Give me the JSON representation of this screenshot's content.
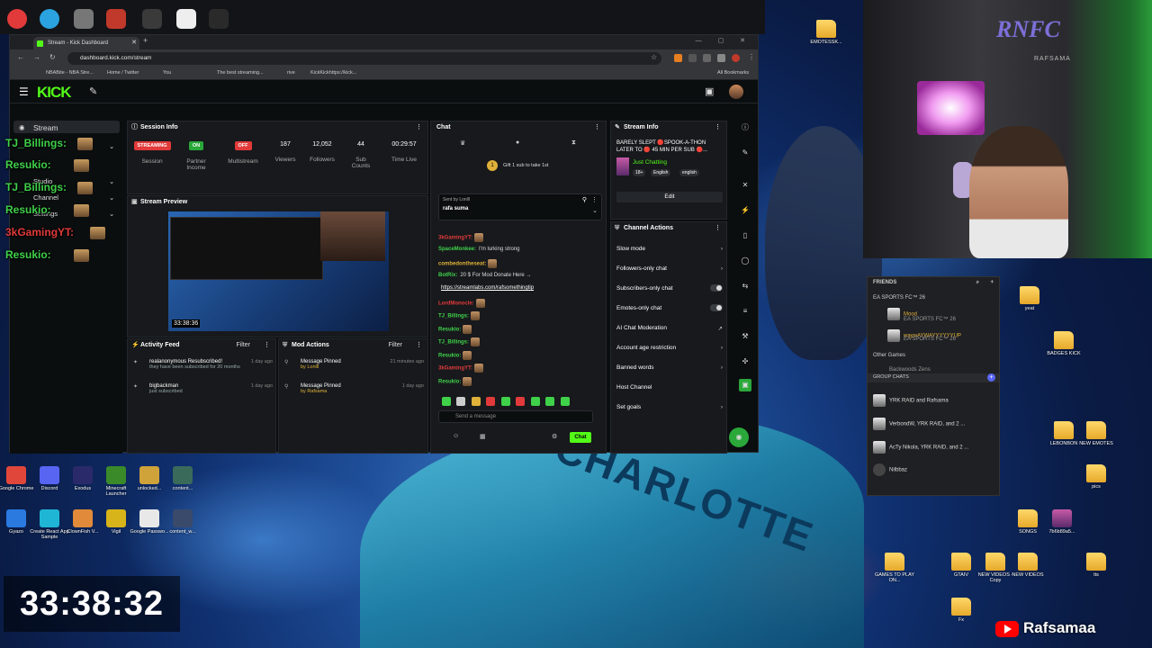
{
  "browser": {
    "tab_title": "Stream - Kick Dashboard",
    "new_tab": "+",
    "window_controls": "— ▢ ✕",
    "url": "dashboard.kick.com/stream",
    "bookmarks": [
      "NBABite - NBA Stre...",
      "Home / Twitter",
      "You",
      "The best streaming...",
      "rive",
      "KickKickhttps://kick..."
    ],
    "all_bookmarks": "All Bookmarks"
  },
  "kick": {
    "logo": "KICK",
    "sidebar": {
      "stream": "Stream",
      "studio": "Studio",
      "channel": "Channel",
      "settings": "Settings"
    },
    "overlay_names": [
      {
        "text": "TJ_Billings:",
        "color": "#3fd14a"
      },
      {
        "text": "Resukio:",
        "color": "#3fd14a"
      },
      {
        "text": "TJ_Billings:",
        "color": "#3fd14a"
      },
      {
        "text": "Resukio:",
        "color": "#3fd14a"
      },
      {
        "text": "3kGamingYT:",
        "color": "#e23a3a"
      },
      {
        "text": "Resukio:",
        "color": "#3fd14a"
      }
    ],
    "session_info": {
      "title": "Session Info",
      "streaming_pill": "STREAMING",
      "session_label": "Session",
      "partner_pill": "ON",
      "partner_label": "Partner Income",
      "multistream_pill": "OFF",
      "multistream_label": "Multistream",
      "viewers": "187",
      "viewers_label": "Viewers",
      "followers": "12,052",
      "followers_label": "Followers",
      "subs": "44",
      "subs_label": "Sub Counts",
      "time": "00:29:57",
      "time_label": "Time Live"
    },
    "stream_preview": {
      "title": "Stream Preview",
      "timestamp": "33:38:36"
    },
    "activity_feed": {
      "title": "Activity Feed",
      "filter": "Filter",
      "items": [
        {
          "text": "realanonymous Resubscribed!",
          "sub": "they have been subscribed for 20 months",
          "time": "1 day ago"
        },
        {
          "text": "bigbackman",
          "sub": "just subscribed",
          "time": "1 day ago"
        }
      ]
    },
    "mod_actions": {
      "title": "Mod Actions",
      "filter": "Filter",
      "items": [
        {
          "text": "Message Pinned",
          "sub": "by Lonlll",
          "time": "21 minutes ago"
        },
        {
          "text": "Message Pinned",
          "sub": "by Rafsama",
          "time": "1 day ago"
        }
      ]
    },
    "chat": {
      "title": "Chat",
      "gift_text": "Gift 1 sub to take 1st",
      "pinned_by": "Sent by Lonlll",
      "pinned_text": "rafa suma",
      "messages": [
        {
          "name": "3kGamingYT:",
          "color": "#e23a3a",
          "text": ""
        },
        {
          "name": "SpaceMonkee:",
          "color": "#3fd14a",
          "text": "I'm lurking strong"
        },
        {
          "name": "combedontheseat:",
          "color": "#e0b13a",
          "text": ""
        },
        {
          "name": "BotRix:",
          "color": "#3fd14a",
          "text": "20 $ For Mod Donate Here →"
        },
        {
          "name": "",
          "color": "#ffffff",
          "text": "https://streamlabs.com/rafsomethingtip"
        },
        {
          "name": "LordMonocle:",
          "color": "#e23a3a",
          "text": ""
        },
        {
          "name": "TJ_Billings:",
          "color": "#3fd14a",
          "text": ""
        },
        {
          "name": "Resukio:",
          "color": "#3fd14a",
          "text": ""
        },
        {
          "name": "TJ_Billings:",
          "color": "#3fd14a",
          "text": ""
        },
        {
          "name": "Resukio:",
          "color": "#3fd14a",
          "text": ""
        },
        {
          "name": "3kGamingYT:",
          "color": "#e23a3a",
          "text": ""
        },
        {
          "name": "Resukio:",
          "color": "#3fd14a",
          "text": ""
        }
      ],
      "input_placeholder": "Send a message",
      "send_button": "Chat"
    },
    "stream_info": {
      "title": "Stream Info",
      "stream_title": "BARELY SLEPT 🔴SPOOK-A-THON LATER TO 🔴 45 MIN PER SUB 🔴...",
      "category": "Just Chatting",
      "tags": [
        "18+",
        "English",
        "english"
      ],
      "edit": "Edit"
    },
    "channel_actions": {
      "title": "Channel Actions",
      "items": [
        {
          "label": "Slow mode",
          "control": "arrow"
        },
        {
          "label": "Followers-only chat",
          "control": "arrow"
        },
        {
          "label": "Subscribers-only chat",
          "control": "toggle"
        },
        {
          "label": "Emotes-only chat",
          "control": "toggle"
        },
        {
          "label": "AI Chat Moderation",
          "control": "ext"
        },
        {
          "label": "Account age restriction",
          "control": "arrow"
        },
        {
          "label": "Banned words",
          "control": "arrow"
        },
        {
          "label": "Host Channel",
          "control": "none"
        },
        {
          "label": "Set goals",
          "control": "arrow"
        }
      ]
    }
  },
  "desktop": {
    "left_icons": [
      {
        "label": "Google Chrome",
        "color": "#e0473a"
      },
      {
        "label": "Discord",
        "color": "#5865f2"
      },
      {
        "label": "Exodus",
        "color": "#2a2a6a"
      },
      {
        "label": "Minecraft Launcher",
        "color": "#3a8a2a"
      },
      {
        "label": "unlocked...",
        "color": "#cfa23a"
      },
      {
        "label": "content...",
        "color": "#3a6a5a"
      },
      {
        "label": "Gyazo",
        "color": "#2a7ae0"
      },
      {
        "label": "Create React App Sample",
        "color": "#1fb6d6"
      },
      {
        "label": "ClownFish V...",
        "color": "#e08a3a"
      },
      {
        "label": "Vigil",
        "color": "#d6b41a"
      },
      {
        "label": "Google Passwo...",
        "color": "#e8e8e8"
      },
      {
        "label": "content_w...",
        "color": "#3a4a6a"
      }
    ],
    "right_icons": [
      {
        "label": "EMOTESSK...",
        "type": "folder"
      },
      {
        "label": "yeat",
        "type": "folder"
      },
      {
        "label": "BADGES KICK",
        "type": "folder"
      },
      {
        "label": "LEBONBON",
        "type": "folder"
      },
      {
        "label": "NEW EMOTES",
        "type": "folder"
      },
      {
        "label": "pics",
        "type": "folder"
      },
      {
        "label": "SONGS",
        "type": "folder"
      },
      {
        "label": "7b6b89a5...",
        "type": "file"
      },
      {
        "label": "GAMES TO PLAY ON...",
        "type": "folder"
      },
      {
        "label": "GTAIV",
        "type": "folder"
      },
      {
        "label": "NEW VIDEOS - Copy",
        "type": "folder"
      },
      {
        "label": "NEW VIDEOS",
        "type": "folder"
      },
      {
        "label": "tts",
        "type": "folder"
      },
      {
        "label": "Fx",
        "type": "folder"
      }
    ],
    "clock": "33:38:32",
    "youtube_name": "Rafsamaa"
  },
  "webcam": {
    "logo": "RNFC",
    "subtitle": "RAFSAMA"
  },
  "friends": {
    "header": "FRIENDS",
    "top_game": "EA SPORTS FC™ 26",
    "entries": [
      {
        "name": "Mood",
        "status": "EA SPORTS FC™ 26"
      },
      {
        "name": "waywAYWAYYYYYYUP",
        "status": "EA SPORTS FC™ 26"
      }
    ],
    "other_games": "Other Games",
    "other_game_name": "Backwoods Zens",
    "group_chats_header": "GROUP CHATS",
    "group_chats": [
      "YRK RAID and Rafsama",
      "VerbondW, YRK RAID, and 2 ...",
      "AcTy Nikola, YRK RAID, and 2 ...",
      "Nilbbaz"
    ]
  },
  "colors": {
    "kick_green": "#53fc18",
    "streaming_red": "#e23a3a",
    "panel_bg": "#17191c"
  }
}
